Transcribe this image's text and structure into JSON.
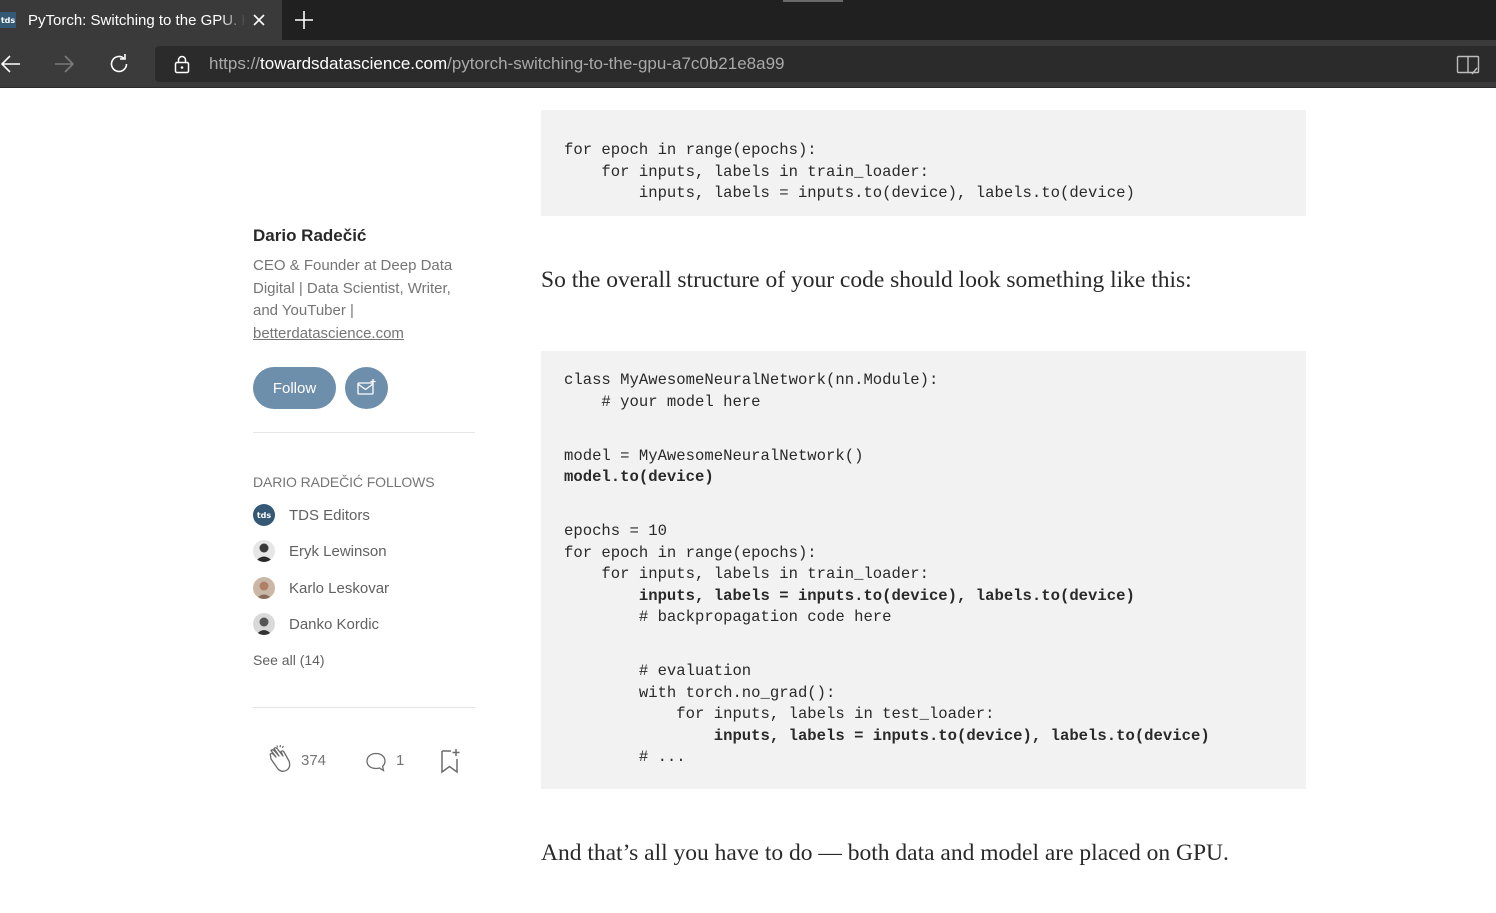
{
  "browser": {
    "tab_title": "PyTorch: Switching to the GPU. How",
    "tab_favicon_text": "tds",
    "url_protocol": "https://",
    "url_host": "towardsdatascience.com",
    "url_path": "/pytorch-switching-to-the-gpu-a7c0b21e8a99",
    "icons": [
      "close-icon",
      "plus-icon",
      "back-arrow-icon",
      "forward-arrow-icon",
      "refresh-icon",
      "lock-icon",
      "reader-mode-icon"
    ]
  },
  "sidebar": {
    "author_name": "Dario Radečić",
    "bio_text": "CEO & Founder at Deep Data Digital | Data Scientist, Writer, and YouTuber |",
    "bio_link": "betterdatascience.com",
    "follow_label": "Follow",
    "follows_heading": "DARIO RADEČIĆ FOLLOWS",
    "follows": [
      {
        "name": "TDS Editors",
        "avatar_text": "tds"
      },
      {
        "name": "Eryk Lewinson"
      },
      {
        "name": "Karlo Leskovar"
      },
      {
        "name": "Danko Kordic"
      }
    ],
    "see_all": "See all (14)",
    "clap_count": "374",
    "comment_count": "1"
  },
  "article": {
    "code_top": [
      {
        "text": "for epoch in range(epochs):",
        "bold": false
      },
      {
        "text": "    for inputs, labels in train_loader:",
        "bold": false
      },
      {
        "text": "        inputs, labels = inputs.to(device), labels.to(device)",
        "bold": false
      }
    ],
    "paragraph_1": "So the overall structure of your code should look something like this:",
    "code_main": [
      {
        "text": "class MyAwesomeNeuralNetwork(nn.Module):",
        "bold": false
      },
      {
        "text": "    # your model here",
        "bold": false
      },
      {
        "text": "",
        "bold": false
      },
      {
        "text": "model = MyAwesomeNeuralNetwork()",
        "bold": false
      },
      {
        "text": "model.to(device)",
        "bold": true
      },
      {
        "text": "",
        "bold": false
      },
      {
        "text": "epochs = 10",
        "bold": false
      },
      {
        "text": "for epoch in range(epochs):",
        "bold": false
      },
      {
        "text": "    for inputs, labels in train_loader:",
        "bold": false
      },
      {
        "text": "        inputs, labels = inputs.to(device), labels.to(device)",
        "bold": true
      },
      {
        "text": "        # backpropagation code here",
        "bold": false
      },
      {
        "text": "",
        "bold": false
      },
      {
        "text": "        # evaluation",
        "bold": false
      },
      {
        "text": "        with torch.no_grad():",
        "bold": false
      },
      {
        "text": "            for inputs, labels in test_loader:",
        "bold": false
      },
      {
        "text": "                inputs, labels = inputs.to(device), labels.to(device)",
        "bold": true
      },
      {
        "text": "        # ...",
        "bold": false
      }
    ],
    "paragraph_2": "And that’s all you have to do — both data and model are placed on GPU."
  },
  "colors": {
    "follow_button": "#6e8fab",
    "code_background": "#f2f2f2",
    "text_primary": "#292929",
    "text_secondary": "#757575"
  }
}
